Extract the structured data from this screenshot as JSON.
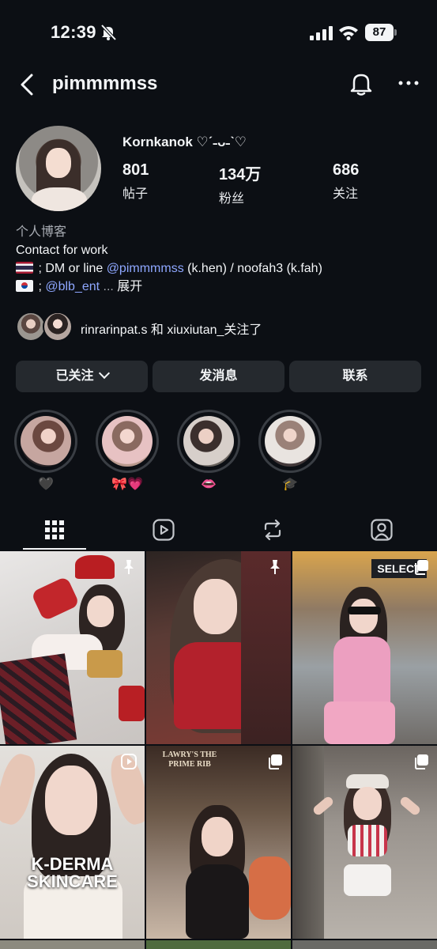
{
  "status_bar": {
    "time": "12:39",
    "battery": "87"
  },
  "header": {
    "username": "pimmmmss"
  },
  "profile": {
    "display_name": "Kornkanok ♡ˊ˗ᴗ˗ˋ♡",
    "stats": [
      {
        "value": "801",
        "label": "帖子"
      },
      {
        "value": "134万",
        "label": "粉丝"
      },
      {
        "value": "686",
        "label": "关注"
      }
    ],
    "bio": {
      "category": "个人博客",
      "line1": "Contact for work",
      "line2_pre": " ; DM or line ",
      "line2_mention": "@pimmmmss",
      "line2_post": " (k.hen) / noofah3 (k.fah)",
      "line3_pre": " ; ",
      "line3_mention": "@blb_ent",
      "line3_ellipsis": " ...",
      "line3_more": " 展开"
    },
    "followed_by": "rinrarinpat.s 和 xiuxiutan_关注了"
  },
  "actions": {
    "following": "已关注",
    "message": "发消息",
    "contact": "联系"
  },
  "highlights": [
    {
      "label": "🖤"
    },
    {
      "label": "🎀💗"
    },
    {
      "label": "👄"
    },
    {
      "label": "🎓"
    }
  ],
  "grid": {
    "cell4_text": "K-DERMA\nSKINCARE",
    "cell4_line1": "K-DERMA",
    "cell4_line2": "SKINCARE",
    "cell5_sign": "LAWRY'S THE PRIME RIB",
    "cell3_sign": "SELECT"
  },
  "colors": {
    "background": "#0c0f14",
    "button": "#25292e",
    "mention": "#8ea7ff"
  }
}
